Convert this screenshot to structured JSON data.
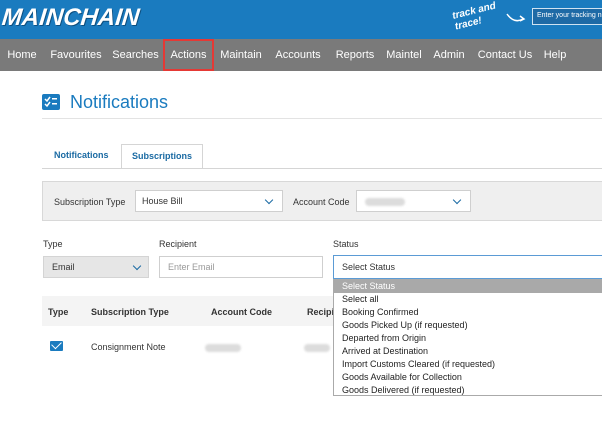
{
  "brand": {
    "logo": "MAINCHAIN",
    "track_badge": "track and trace!",
    "track_placeholder": "Enter your tracking n"
  },
  "nav": [
    {
      "label": "Home"
    },
    {
      "label": "Favourites"
    },
    {
      "label": "Searches"
    },
    {
      "label": "Actions",
      "active": true
    },
    {
      "label": "Maintain"
    },
    {
      "label": "Accounts"
    },
    {
      "label": "Reports"
    },
    {
      "label": "Maintel"
    },
    {
      "label": "Admin"
    },
    {
      "label": "Contact Us"
    },
    {
      "label": "Help"
    }
  ],
  "page": {
    "title": "Notifications",
    "title_icon": "checklist-icon"
  },
  "tabs": [
    {
      "label": "Notifications"
    },
    {
      "label": "Subscriptions",
      "active": true
    }
  ],
  "filters": {
    "subscription_type_label": "Subscription Type",
    "subscription_type_value": "House Bill",
    "account_code_label": "Account Code"
  },
  "form": {
    "type_label": "Type",
    "type_value": "Email",
    "recipient_label": "Recipient",
    "recipient_placeholder": "Enter Email",
    "status_label": "Status",
    "status_value": "Select Status"
  },
  "table": {
    "headers": [
      "Type",
      "Subscription Type",
      "Account Code",
      "Recipi"
    ],
    "rows": [
      {
        "type_icon": "mail-icon",
        "subscription_type": "Consignment Note"
      }
    ]
  },
  "status_options": [
    "Select Status",
    "Select all",
    "Booking Confirmed",
    "Goods Picked Up (if requested)",
    "Departed from Origin",
    "Arrived at Destination",
    "Import Customs Cleared (if requested)",
    "Goods Available for Collection",
    "Goods Delivered (if requested)"
  ],
  "colors": {
    "brand_blue": "#1a7bbf",
    "nav_gray": "#7a7a7a",
    "active_outline": "#e53935"
  }
}
